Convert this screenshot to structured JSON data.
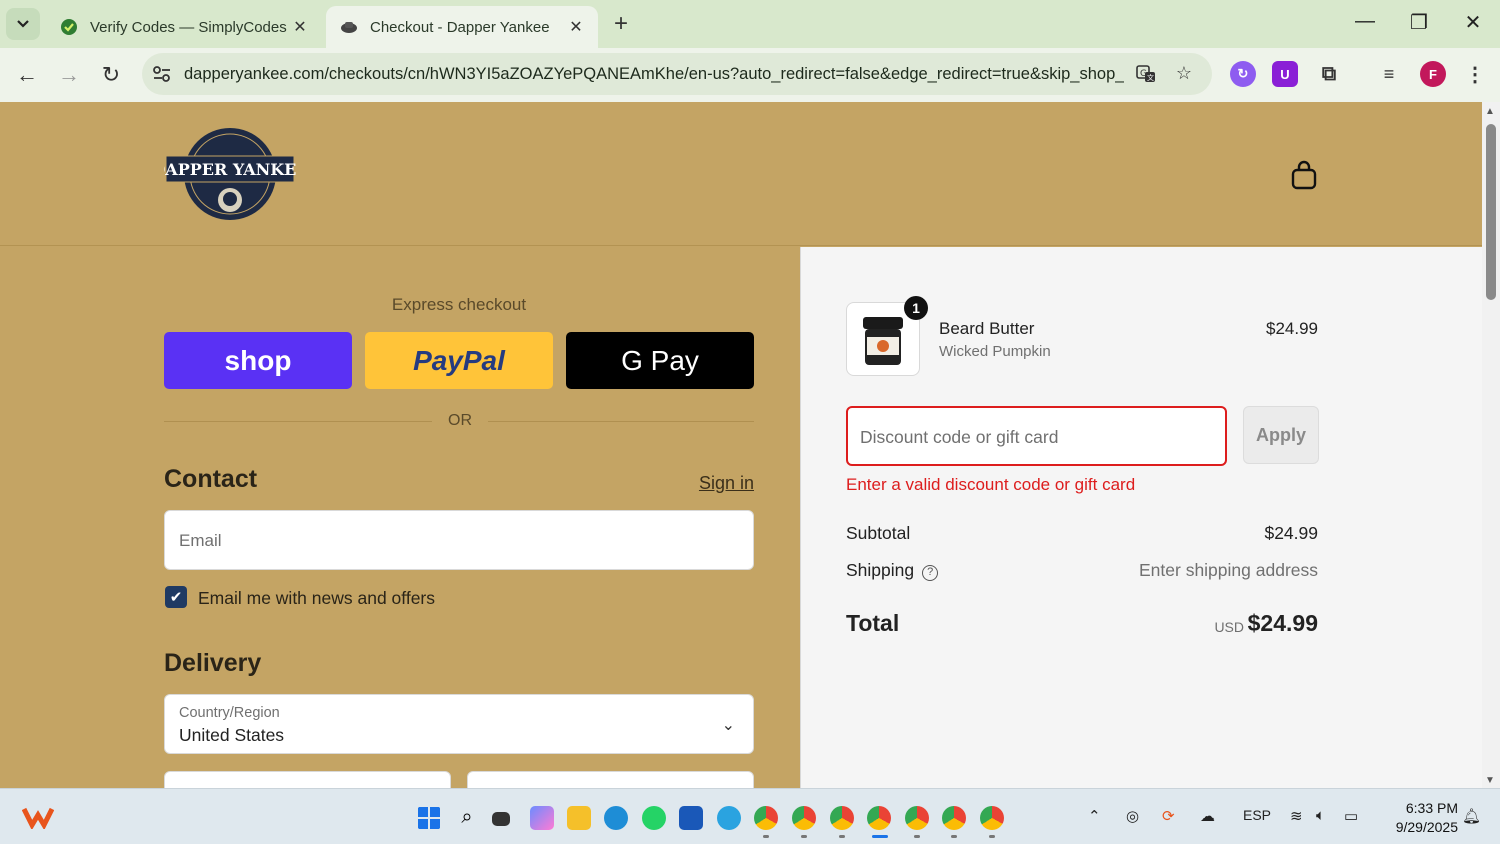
{
  "browser": {
    "tabs": [
      {
        "title": "Verify Codes — SimplyCodes",
        "active": false
      },
      {
        "title": "Checkout - Dapper Yankee",
        "active": true
      }
    ],
    "url": "dapperyankee.com/checkouts/cn/hWN3YI5aZOAZYePQANEAmKhe/en-us?auto_redirect=false&edge_redirect=true&skip_shop_...",
    "profile_initial": "F"
  },
  "header": {
    "logo_text": "DAPPER YANKEE"
  },
  "express": {
    "title": "Express checkout",
    "shop_label": "shop",
    "paypal_label": "PayPal",
    "gpay_label": "G Pay",
    "or_label": "OR"
  },
  "contact": {
    "title": "Contact",
    "signin": "Sign in",
    "email_placeholder": "Email",
    "newsletter_label": "Email me with news and offers",
    "newsletter_checked": true
  },
  "delivery": {
    "title": "Delivery",
    "country_label": "Country/Region",
    "country_value": "United States"
  },
  "summary": {
    "item": {
      "qty": "1",
      "name": "Beard Butter",
      "variant": "Wicked Pumpkin",
      "price": "$24.99"
    },
    "discount_placeholder": "Discount code or gift card",
    "apply_label": "Apply",
    "error": "Enter a valid discount code or gift card",
    "subtotal_label": "Subtotal",
    "subtotal_value": "$24.99",
    "shipping_label": "Shipping",
    "shipping_value": "Enter shipping address",
    "total_label": "Total",
    "currency": "USD",
    "total_value": "$24.99"
  },
  "taskbar": {
    "language": "ESP",
    "time": "6:33 PM",
    "date": "9/29/2025"
  },
  "colors": {
    "page_bg": "#c4a464",
    "shop_purple": "#5a31f4",
    "paypal_yellow": "#ffc439",
    "error_red": "#dd1d1d",
    "checkbox_blue": "#1f3a63"
  }
}
